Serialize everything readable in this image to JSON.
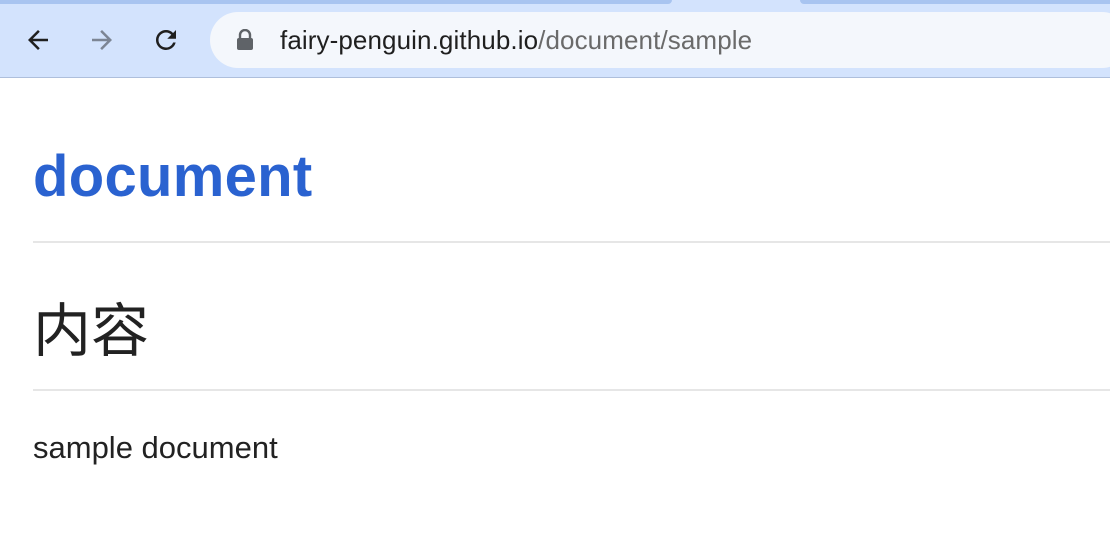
{
  "browser": {
    "url_host": "fairy-penguin.github.io",
    "url_path": "/document/sample",
    "icons": {
      "back": "arrow-left-icon",
      "forward": "arrow-right-icon",
      "reload": "reload-icon",
      "lock": "lock-icon"
    }
  },
  "page": {
    "site_title": "document",
    "section_heading": "内容",
    "body_text": "sample document"
  },
  "colors": {
    "title_link": "#2a62d0",
    "toolbar_bg": "#d3e3fd",
    "omnibox_bg": "#f4f7fc",
    "text": "#222222"
  }
}
